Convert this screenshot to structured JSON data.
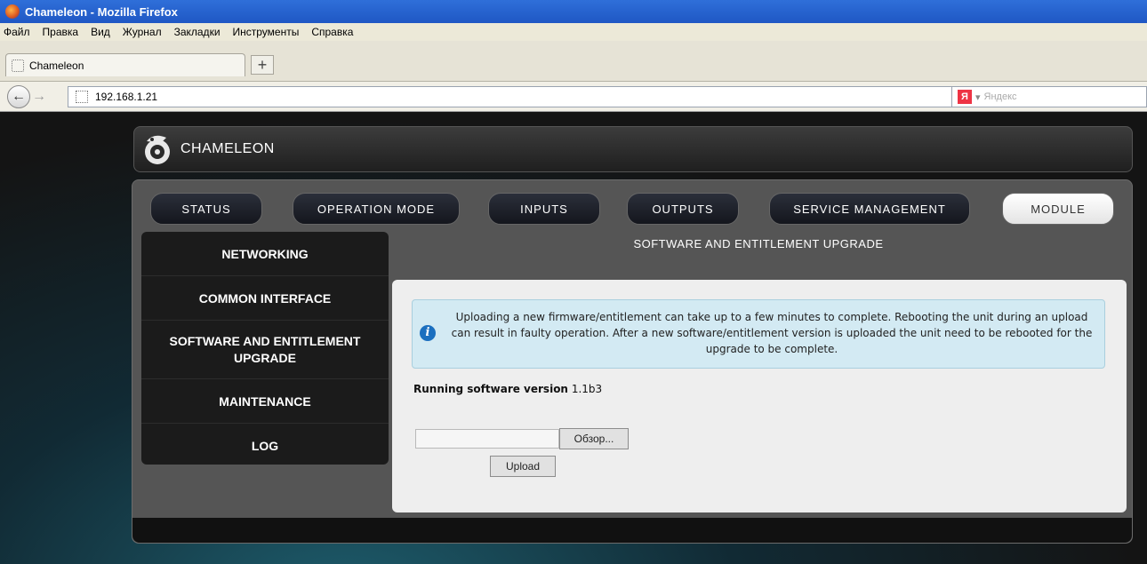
{
  "window": {
    "title": "Chameleon - Mozilla Firefox"
  },
  "menu": {
    "items": [
      "Файл",
      "Правка",
      "Вид",
      "Журнал",
      "Закладки",
      "Инструменты",
      "Справка"
    ]
  },
  "tab": {
    "title": "Chameleon",
    "new_tab": "+"
  },
  "nav": {
    "url": "192.168.1.21",
    "search_placeholder": "Яндекс",
    "search_engine_letter": "Я"
  },
  "brand": {
    "name": "CHAMELEON"
  },
  "topnav": [
    "STATUS",
    "OPERATION MODE",
    "INPUTS",
    "OUTPUTS",
    "SERVICE MANAGEMENT",
    "MODULE"
  ],
  "sidebar": [
    "NETWORKING",
    "COMMON INTERFACE",
    "SOFTWARE AND ENTITLEMENT UPGRADE",
    "MAINTENANCE",
    "LOG"
  ],
  "section_title": "SOFTWARE AND ENTITLEMENT UPGRADE",
  "info_message": "Uploading a new firmware/entitlement can take up to a few minutes to complete. Rebooting the unit during an upload can result in faulty operation. After a new software/entitlement version is uploaded the unit need to be rebooted for the upgrade to be complete.",
  "running": {
    "label": "Running software version",
    "version": "1.1b3"
  },
  "buttons": {
    "browse": "Обзор...",
    "upload": "Upload"
  },
  "colors": {
    "active_tab": "#ffffff",
    "info_bg": "#d3eaf3",
    "content_bg": "#eeeeee"
  }
}
